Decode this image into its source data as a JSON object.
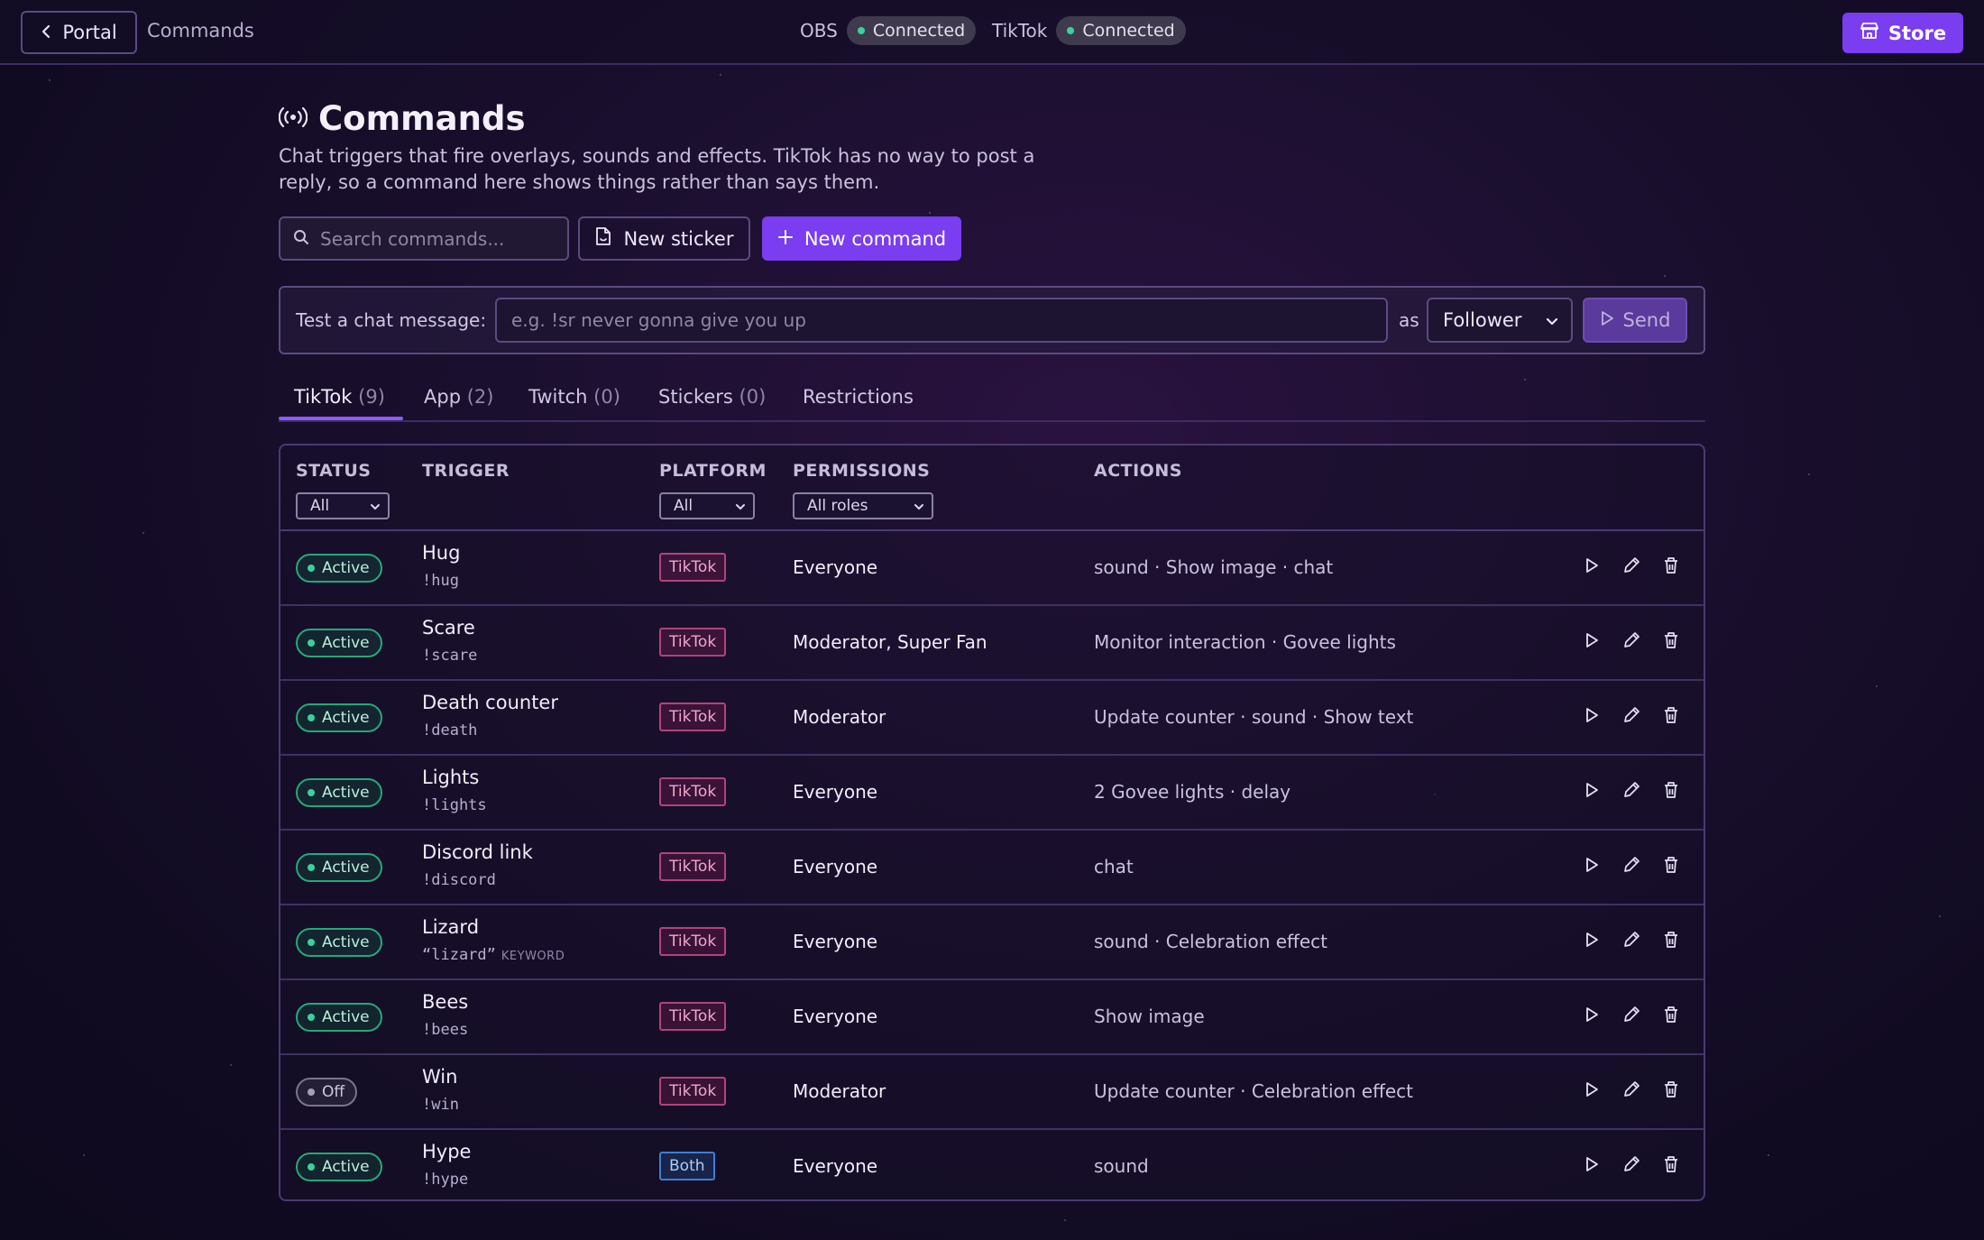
{
  "topbar": {
    "portal_label": "Portal",
    "breadcrumb": "Commands",
    "obs_label": "OBS",
    "obs_status": "Connected",
    "tiktok_label": "TikTok",
    "tiktok_status": "Connected",
    "store_label": "Store"
  },
  "header": {
    "title": "Commands",
    "description": "Chat triggers that fire overlays, sounds and effects. TikTok has no way to post a reply, so a command here shows things rather than says them."
  },
  "toolbar": {
    "search_placeholder": "Search commands...",
    "new_sticker_label": "New sticker",
    "new_command_label": "New command"
  },
  "test": {
    "label": "Test a chat message:",
    "placeholder": "e.g. !sr never gonna give you up",
    "as_label": "as",
    "role_value": "Follower",
    "send_label": "Send"
  },
  "tabs": [
    {
      "label": "TikTok",
      "count": "(9)"
    },
    {
      "label": "App",
      "count": "(2)"
    },
    {
      "label": "Twitch",
      "count": "(0)"
    },
    {
      "label": "Stickers",
      "count": "(0)"
    },
    {
      "label": "Restrictions",
      "count": ""
    }
  ],
  "table": {
    "headers": {
      "status": "STATUS",
      "trigger": "TRIGGER",
      "platform": "PLATFORM",
      "permissions": "PERMISSIONS",
      "actions": "ACTIONS"
    },
    "filters": {
      "status": "All",
      "platform": "All",
      "permissions": "All roles"
    },
    "rows": [
      {
        "status": "Active",
        "name": "Hug",
        "cmd": "!hug",
        "kw": "",
        "platform": "TikTok",
        "perm": "Everyone",
        "actions": "sound · Show image · chat"
      },
      {
        "status": "Active",
        "name": "Scare",
        "cmd": "!scare",
        "kw": "",
        "platform": "TikTok",
        "perm": "Moderator, Super Fan",
        "actions": "Monitor interaction · Govee lights"
      },
      {
        "status": "Active",
        "name": "Death counter",
        "cmd": "!death",
        "kw": "",
        "platform": "TikTok",
        "perm": "Moderator",
        "actions": "Update counter · sound · Show text"
      },
      {
        "status": "Active",
        "name": "Lights",
        "cmd": "!lights",
        "kw": "",
        "platform": "TikTok",
        "perm": "Everyone",
        "actions": "2 Govee lights · delay"
      },
      {
        "status": "Active",
        "name": "Discord link",
        "cmd": "!discord",
        "kw": "",
        "platform": "TikTok",
        "perm": "Everyone",
        "actions": "chat"
      },
      {
        "status": "Active",
        "name": "Lizard",
        "cmd": "“lizard”",
        "kw": "KEYWORD",
        "platform": "TikTok",
        "perm": "Everyone",
        "actions": "sound · Celebration effect"
      },
      {
        "status": "Active",
        "name": "Bees",
        "cmd": "!bees",
        "kw": "",
        "platform": "TikTok",
        "perm": "Everyone",
        "actions": "Show image"
      },
      {
        "status": "Off",
        "name": "Win",
        "cmd": "!win",
        "kw": "",
        "platform": "TikTok",
        "perm": "Moderator",
        "actions": "Update counter · Celebration effect"
      },
      {
        "status": "Active",
        "name": "Hype",
        "cmd": "!hype",
        "kw": "",
        "platform": "Both",
        "perm": "Everyone",
        "actions": "sound"
      }
    ]
  },
  "colors": {
    "accent": "#7a3df0",
    "active_green": "#37d39b",
    "tiktok_pink": "#b0447c",
    "both_blue": "#3f7fd0"
  }
}
